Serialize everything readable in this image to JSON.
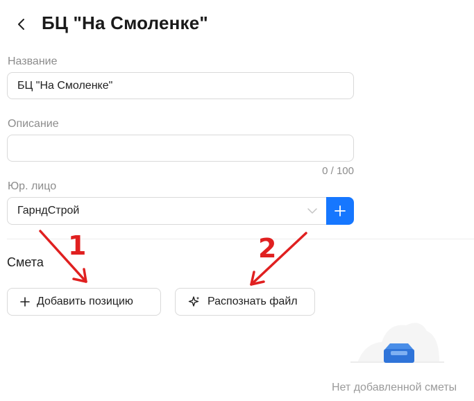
{
  "header": {
    "back_icon": "chevron-left-icon",
    "title": "БЦ \"На Смоленке\""
  },
  "form": {
    "name_label": "Название",
    "name_value": "БЦ \"На Смоленке\"",
    "description_label": "Описание",
    "description_value": "",
    "description_counter": "0 / 100",
    "legal_entity_label": "Юр. лицо",
    "legal_entity_value": "ГарндСтрой",
    "legal_entity_add_icon": "plus-icon"
  },
  "estimate": {
    "section_title": "Смета",
    "add_position_label": "Добавить позицию",
    "recognize_file_label": "Распознать файл",
    "empty_text": "Нет добавленной сметы"
  },
  "annotations": {
    "marker_1": "1",
    "marker_2": "2",
    "color": "#e02020"
  },
  "colors": {
    "accent": "#1677ff",
    "border": "#d9d9d9",
    "muted_text": "#8c8c8c"
  }
}
